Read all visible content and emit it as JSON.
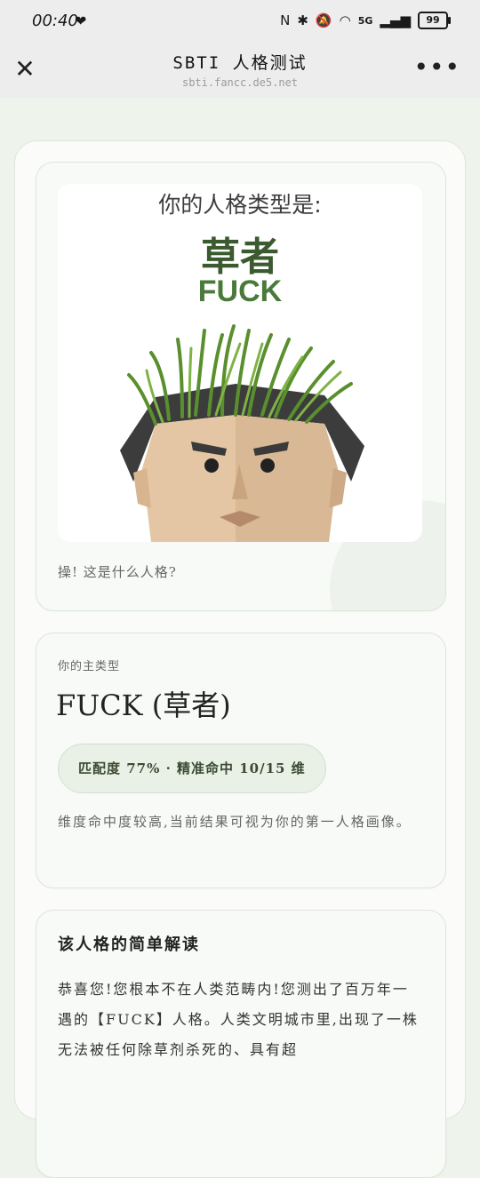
{
  "status_bar": {
    "time": "00:40",
    "network_label": "5G",
    "battery": "99"
  },
  "titlebar": {
    "title": "SBTI 人格测试",
    "url": "sbti.fancc.de5.net"
  },
  "result_image": {
    "heading": "你的人格类型是:",
    "type_cn": "草者",
    "type_en": "FUCK",
    "caption": "操! 这是什么人格?"
  },
  "main_type": {
    "kicker": "你的主类型",
    "title": "FUCK (草者)",
    "match": "匹配度 77% · 精准命中 10/15 维",
    "description": "维度命中度较高,当前结果可视为你的第一人格画像。"
  },
  "interpretation": {
    "title": "该人格的简单解读",
    "text": "恭喜您!您根本不在人类范畴内!您测出了百万年一遇的【FUCK】人格。人类文明城市里,出现了一株无法被任何除草剂杀死的、具有超"
  },
  "icons": {
    "close": "close-icon",
    "more": "more-icon",
    "wifi": "wifi-icon",
    "bluetooth": "bluetooth-icon",
    "nfc": "nfc-icon",
    "mute": "bell-mute-icon",
    "signal": "signal-icon",
    "battery": "battery-icon"
  },
  "colors": {
    "accent_green": "#4a7a3a",
    "dark_green": "#3b5a2f",
    "pill_bg": "#e9f0e6"
  }
}
